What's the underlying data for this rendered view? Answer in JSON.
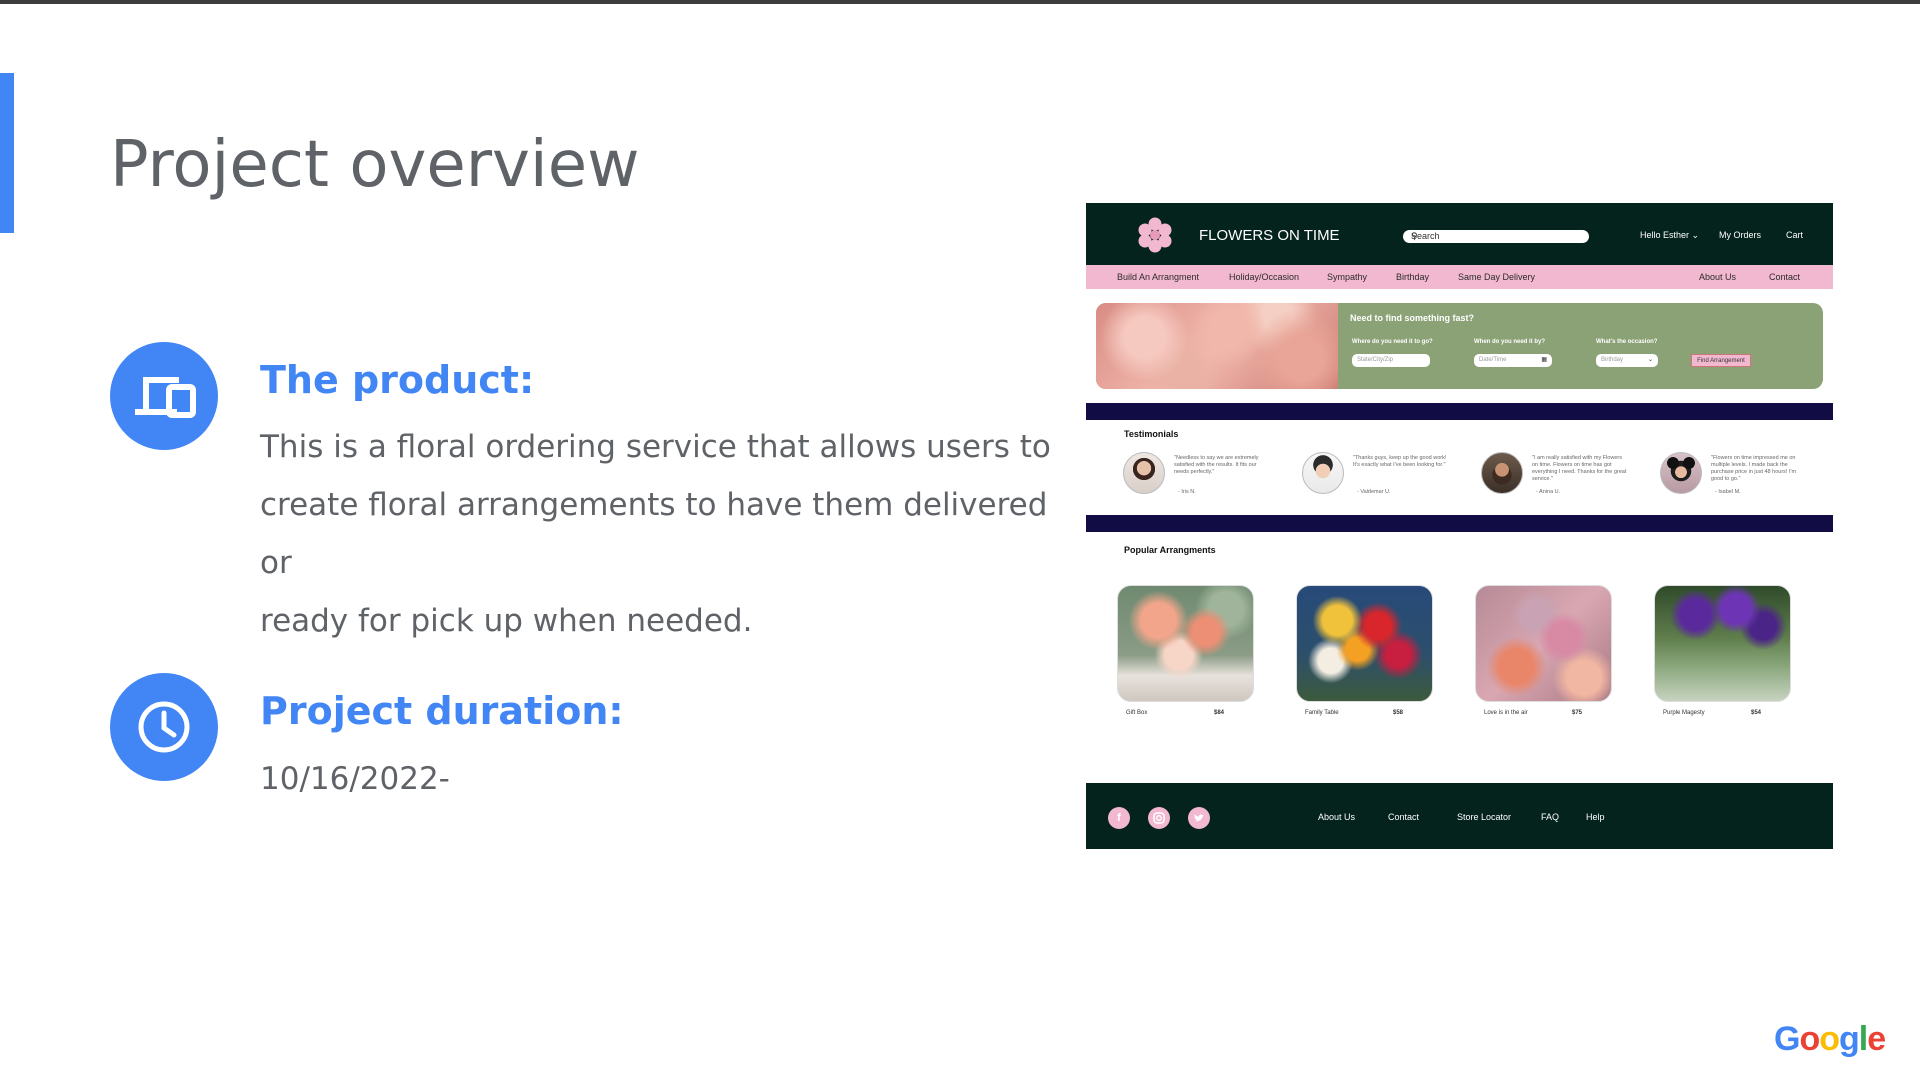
{
  "slide": {
    "title": "Project overview",
    "product": {
      "heading": "The product:",
      "lines": [
        "This is a floral ordering service that allows users to",
        "create floral arrangements to have them delivered or",
        "ready for pick up when needed."
      ],
      "icon": "devices-icon"
    },
    "duration": {
      "heading": "Project duration:",
      "value": "10/16/2022-",
      "icon": "clock-icon"
    }
  },
  "mockup": {
    "brand": "FLOWERS ON TIME",
    "search_placeholder": "Search",
    "header_links": [
      "Hello Esther ⌄",
      "My Orders",
      "Cart"
    ],
    "nav_left": [
      "Build An Arrangment",
      "Holiday/Occasion",
      "Sympathy",
      "Birthday",
      "Same Day Delivery"
    ],
    "nav_right": [
      "About Us",
      "Contact"
    ],
    "finder": {
      "title": "Need to find something fast?",
      "questions": [
        "Where do you need it to go?",
        "When do you need it by?",
        "What's the occasion?"
      ],
      "placeholders": [
        "State/City/Zip",
        "Date/Time",
        "Birthday"
      ],
      "button": "Find Arrangement"
    },
    "testimonials": {
      "title": "Testimonials",
      "items": [
        {
          "quote": "\"Needless to say we are extremely satisfied with the results. It fits our needs perfectly.\"",
          "name": "- Iris N."
        },
        {
          "quote": "\"Thanks guys, keep up the good work! It's exactly what I've been looking for.\"",
          "name": "- Valdemar U."
        },
        {
          "quote": "\"I am really satisfied with my Flowers on time. Flowers on time has got everything I need. Thanks for the great service.\"",
          "name": "- Anina U."
        },
        {
          "quote": "\"Flowers on time impressed me on multiple levels. I made back the purchase price in just 48 hours! I'm good to go.\"",
          "name": "- Isabel M."
        }
      ]
    },
    "popular": {
      "title": "Popular Arrangments",
      "items": [
        {
          "name": "Gift Box",
          "price": "$84"
        },
        {
          "name": "Family Table",
          "price": "$58"
        },
        {
          "name": "Love is in the air",
          "price": "$75"
        },
        {
          "name": "Purple Magesty",
          "price": "$54"
        }
      ]
    },
    "footer_links": [
      "About Us",
      "Contact",
      "Store Locator",
      "FAQ",
      "Help"
    ],
    "social": [
      "facebook-icon",
      "instagram-icon",
      "twitter-icon"
    ]
  },
  "branding": {
    "logo_text": "Google",
    "logo_colors": [
      "#4285f4",
      "#ea4335",
      "#fbbc05",
      "#4285f4",
      "#34a853",
      "#ea4335"
    ]
  },
  "colors": {
    "accent": "#4285f4",
    "body_text": "#5f6368",
    "mock_dark_green": "#05231d",
    "mock_pink": "#f2b8cf",
    "mock_navy": "#120c45",
    "mock_sage": "#8aa276"
  }
}
